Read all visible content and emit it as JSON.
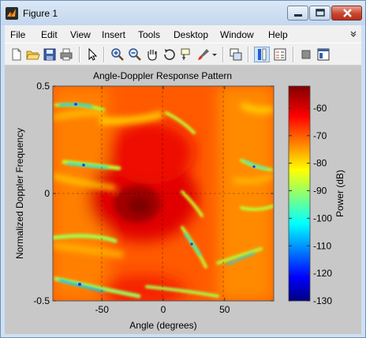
{
  "window": {
    "title": "Figure 1"
  },
  "menu": [
    "File",
    "Edit",
    "View",
    "Insert",
    "Tools",
    "Desktop",
    "Window",
    "Help"
  ],
  "menu_arrow_icon": "double-chevron-down-icon",
  "toolbar": {
    "icons": [
      "new-figure-icon",
      "open-file-icon",
      "save-icon",
      "print-icon",
      "edit-plot-arrow-icon",
      "zoom-in-icon",
      "zoom-out-icon",
      "pan-hand-icon",
      "rotate-3d-icon",
      "data-cursor-icon",
      "brush-icon",
      "link-plot-icon",
      "colorbar-icon",
      "legend-icon",
      "hide-plot-tools-icon",
      "show-plot-tools-icon"
    ]
  },
  "chart_data": {
    "type": "heatmap",
    "title": "Angle-Doppler Response Pattern",
    "xlabel": "Angle (degrees)",
    "ylabel": "Normalized Doppler Frequency",
    "xlim": [
      -90,
      90
    ],
    "ylim": [
      -0.5,
      0.5
    ],
    "xticks": [
      -50,
      0,
      50
    ],
    "xtick_labels": [
      "-50",
      "0",
      "50"
    ],
    "yticks": [
      -0.5,
      0,
      0.5
    ],
    "ytick_labels": [
      "-0.5",
      "0",
      "0.5"
    ],
    "grid": true,
    "colorbar": {
      "label": "Power (dB)",
      "ticks": [
        -60,
        -70,
        -80,
        -90,
        -100,
        -110,
        -120,
        -130
      ],
      "tick_labels": [
        "-60",
        "-70",
        "-80",
        "-90",
        "-100",
        "-110",
        "-120",
        "-130"
      ],
      "range": [
        -130,
        -52
      ],
      "colormap": "jet"
    },
    "peak": {
      "angle": -8,
      "doppler": -0.05,
      "power_db": -52
    }
  }
}
